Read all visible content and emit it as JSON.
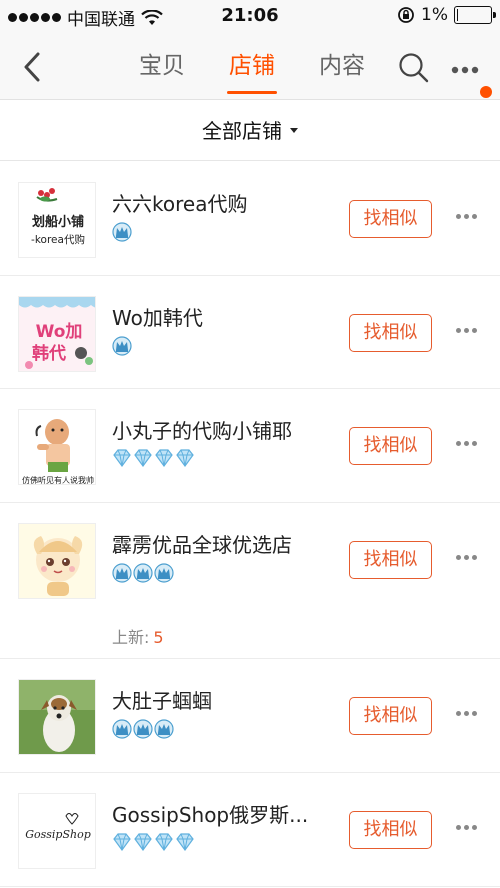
{
  "status_bar": {
    "carrier": "中国联通",
    "time": "21:06",
    "battery": "1%",
    "battery_level": 0.01
  },
  "nav": {
    "tabs": [
      {
        "label": "宝贝",
        "active": false
      },
      {
        "label": "店铺",
        "active": true
      },
      {
        "label": "内容",
        "active": false
      }
    ],
    "accent_color": "#ff5000"
  },
  "filter": {
    "label": "全部店铺"
  },
  "shops": [
    {
      "name": "六六korea代购",
      "badge": "crown",
      "badge_count": 1,
      "thumb_text": "划船小铺 -korea代购",
      "similar_label": "找相似"
    },
    {
      "name": "Wo加韩代",
      "badge": "crown",
      "badge_count": 1,
      "thumb_text": "Wo加韩代",
      "similar_label": "找相似"
    },
    {
      "name": "小丸子的代购小铺耶",
      "badge": "diamond",
      "badge_count": 4,
      "thumb_text": "仿佛听见有人说我帅",
      "similar_label": "找相似"
    },
    {
      "name": "霹雳优品全球优选店",
      "badge": "crown",
      "badge_count": 3,
      "similar_label": "找相似",
      "new_label": "上新:",
      "new_count": "5"
    },
    {
      "name": "大肚子蝈蝈",
      "badge": "crown",
      "badge_count": 3,
      "similar_label": "找相似"
    },
    {
      "name": "GossipShop俄罗斯...",
      "badge": "diamond",
      "badge_count": 4,
      "thumb_text": "GossipShop",
      "similar_label": "找相似"
    }
  ]
}
